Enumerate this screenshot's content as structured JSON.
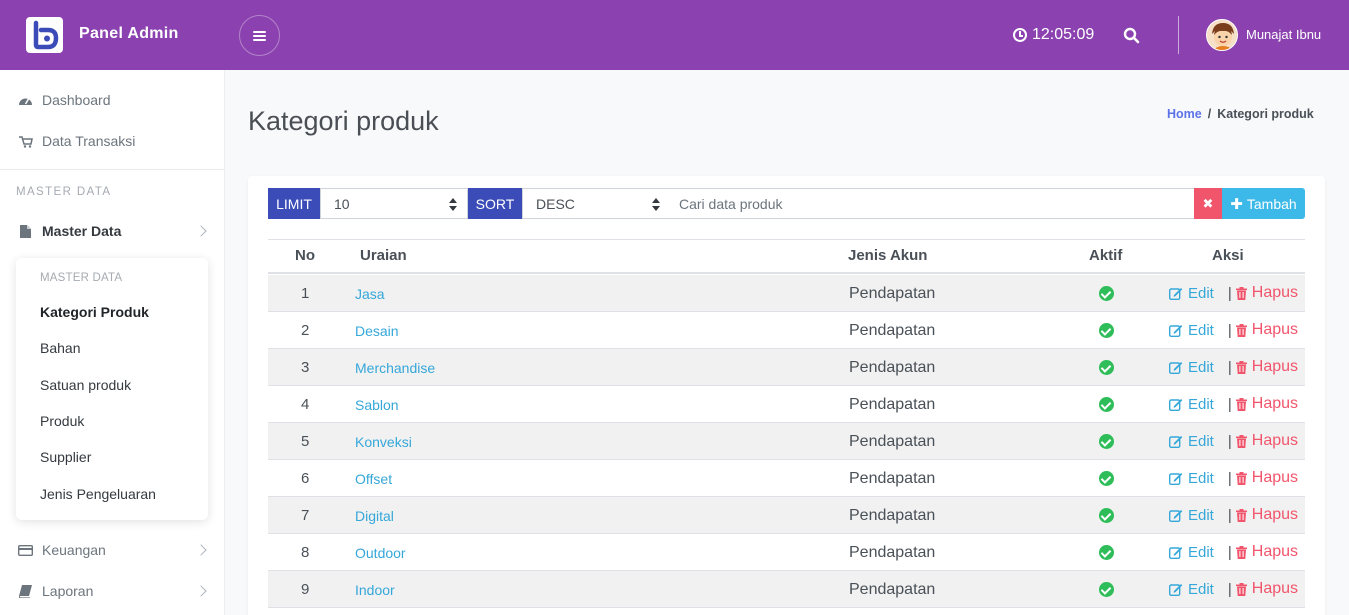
{
  "header": {
    "brand": "Panel Admin",
    "time": "12:05:09",
    "user_name": "Munajat Ibnu",
    "accent_color": "#8b42b0"
  },
  "sidebar": {
    "items_top": [
      {
        "label": "Dashboard",
        "icon": "dashboard-icon"
      },
      {
        "label": "Data Transaksi",
        "icon": "cart-icon"
      }
    ],
    "section_heading": "MASTER DATA",
    "master_data": {
      "label": "Master Data",
      "icon": "file-icon"
    },
    "submenu": {
      "heading": "MASTER DATA",
      "items": [
        "Kategori Produk",
        "Bahan",
        "Satuan produk",
        "Produk",
        "Supplier",
        "Jenis Pengeluaran"
      ],
      "active": "Kategori Produk"
    },
    "items_bottom": [
      {
        "label": "Keuangan",
        "icon": "credit-card-icon"
      },
      {
        "label": "Laporan",
        "icon": "book-icon"
      }
    ]
  },
  "page": {
    "title": "Kategori produk",
    "breadcrumb_home": "Home",
    "breadcrumb_sep": "/",
    "breadcrumb_current": "Kategori produk"
  },
  "toolbar": {
    "limit_label": "LIMIT",
    "limit_value": "10",
    "sort_label": "SORT",
    "sort_value": "DESC",
    "search_placeholder": "Cari data produk",
    "clear_icon": "close-icon",
    "add_label": "Tambah"
  },
  "table": {
    "headers": {
      "no": "No",
      "uraian": "Uraian",
      "jenis_akun": "Jenis Akun",
      "aktif": "Aktif",
      "aksi": "Aksi"
    },
    "edit_label": "Edit",
    "delete_label": "Hapus",
    "separator": "|",
    "rows": [
      {
        "no": "1",
        "uraian": "Jasa",
        "jenis_akun": "Pendapatan"
      },
      {
        "no": "2",
        "uraian": "Desain",
        "jenis_akun": "Pendapatan"
      },
      {
        "no": "3",
        "uraian": "Merchandise",
        "jenis_akun": "Pendapatan"
      },
      {
        "no": "4",
        "uraian": "Sablon",
        "jenis_akun": "Pendapatan"
      },
      {
        "no": "5",
        "uraian": "Konveksi",
        "jenis_akun": "Pendapatan"
      },
      {
        "no": "6",
        "uraian": "Offset",
        "jenis_akun": "Pendapatan"
      },
      {
        "no": "7",
        "uraian": "Digital",
        "jenis_akun": "Pendapatan"
      },
      {
        "no": "8",
        "uraian": "Outdoor",
        "jenis_akun": "Pendapatan"
      },
      {
        "no": "9",
        "uraian": "Indoor",
        "jenis_akun": "Pendapatan"
      }
    ]
  }
}
